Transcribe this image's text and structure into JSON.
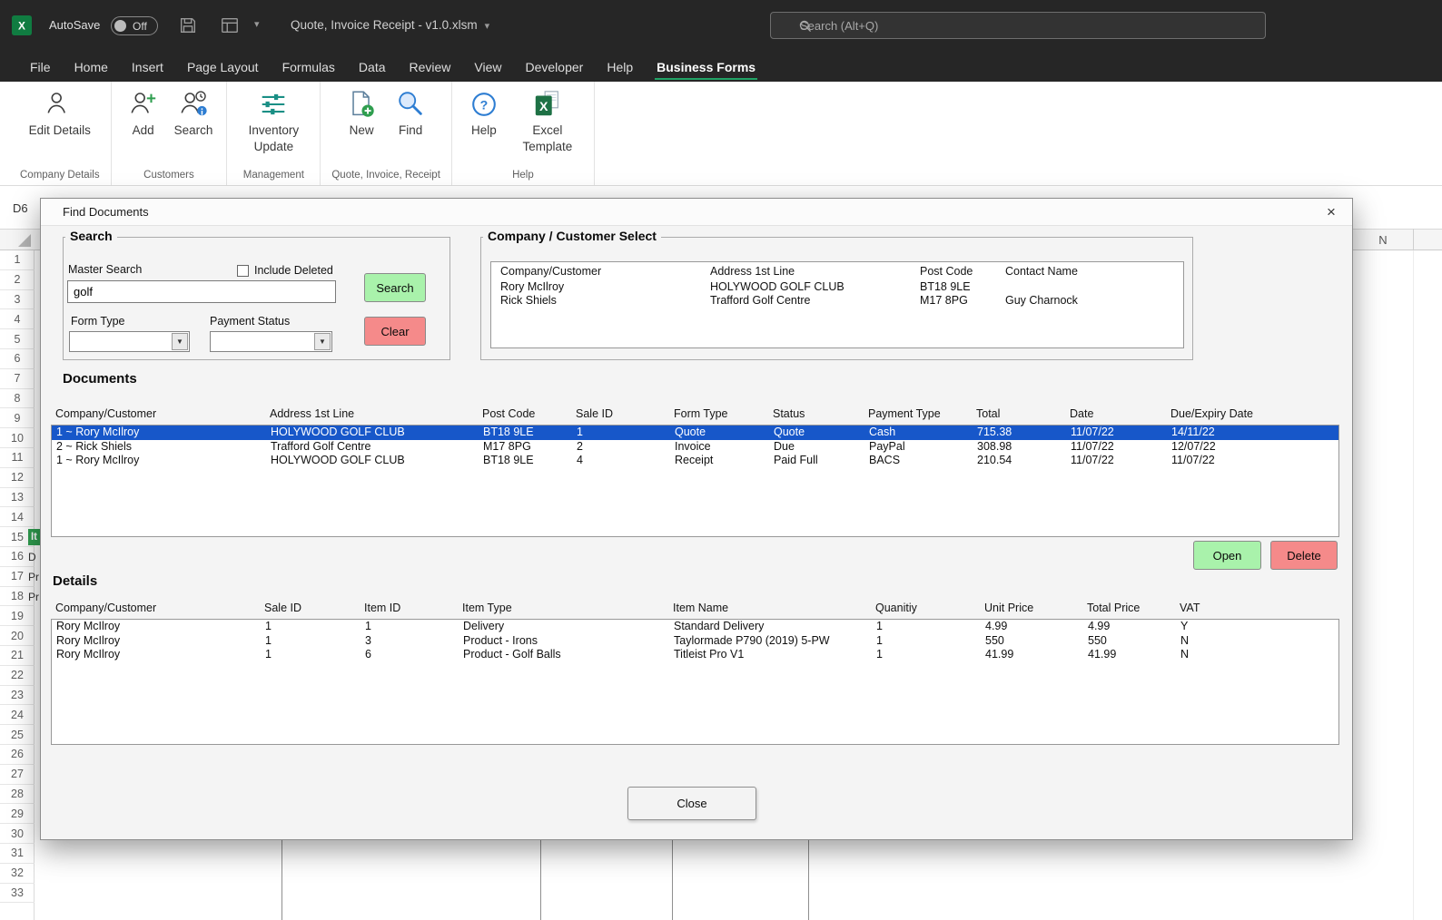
{
  "titlebar": {
    "autosave_label": "AutoSave",
    "autosave_state": "Off",
    "doc_title": "Quote, Invoice Receipt - v1.0.xlsm",
    "search_placeholder": "Search (Alt+Q)"
  },
  "menubar": {
    "items": [
      {
        "label": "File",
        "active": false
      },
      {
        "label": "Home",
        "active": false
      },
      {
        "label": "Insert",
        "active": false
      },
      {
        "label": "Page Layout",
        "active": false
      },
      {
        "label": "Formulas",
        "active": false
      },
      {
        "label": "Data",
        "active": false
      },
      {
        "label": "Review",
        "active": false
      },
      {
        "label": "View",
        "active": false
      },
      {
        "label": "Developer",
        "active": false
      },
      {
        "label": "Help",
        "active": false
      },
      {
        "label": "Business Forms",
        "active": true
      }
    ]
  },
  "ribbon": {
    "groups": [
      {
        "label": "Company Details",
        "buttons": [
          {
            "label": "Edit Details",
            "icon": "person-icon"
          }
        ]
      },
      {
        "label": "Customers",
        "buttons": [
          {
            "label": "Add",
            "icon": "person-add-icon"
          },
          {
            "label": "Search",
            "icon": "person-clock-icon"
          }
        ]
      },
      {
        "label": "Management",
        "buttons": [
          {
            "label": "Inventory Update",
            "icon": "inventory-icon"
          }
        ]
      },
      {
        "label": "Quote, Invoice, Receipt",
        "buttons": [
          {
            "label": "New",
            "icon": "doc-new-icon"
          },
          {
            "label": "Find",
            "icon": "magnifier-icon"
          }
        ]
      },
      {
        "label": "Help",
        "buttons": [
          {
            "label": "Help",
            "icon": "help-icon"
          },
          {
            "label": "Excel Template",
            "icon": "excel-template-icon"
          }
        ]
      }
    ]
  },
  "sheet": {
    "name_box": "D6",
    "col_header": "N",
    "row_numbers": [
      "1",
      "2",
      "3",
      "4",
      "5",
      "6",
      "7",
      "8",
      "9",
      "10",
      "11",
      "12",
      "13",
      "14",
      "15",
      "16",
      "17",
      "18",
      "19",
      "20",
      "21",
      "22",
      "23",
      "24",
      "25",
      "26",
      "27",
      "28",
      "29",
      "30",
      "31",
      "32",
      "33"
    ],
    "cell_fragments": [
      {
        "row": 15,
        "text": "It",
        "green": true
      },
      {
        "row": 16,
        "text": "D",
        "green": false
      },
      {
        "row": 17,
        "text": "Pr",
        "green": false
      },
      {
        "row": 18,
        "text": "Pr",
        "green": false
      }
    ]
  },
  "dialog": {
    "title": "Find Documents",
    "search_group": {
      "label": "Search",
      "master_search_label": "Master Search",
      "master_search_value": "golf",
      "include_deleted_label": "Include Deleted",
      "form_type_label": "Form Type",
      "payment_status_label": "Payment Status",
      "search_button": "Search",
      "clear_button": "Clear"
    },
    "company_select": {
      "label": "Company / Customer Select",
      "columns": [
        "Company/Customer",
        "Address 1st Line",
        "Post Code",
        "Contact Name"
      ],
      "rows": [
        [
          "Rory McIlroy",
          "HOLYWOOD GOLF CLUB",
          "BT18 9LE",
          ""
        ],
        [
          "Rick Shiels",
          "Trafford Golf Centre",
          "M17 8PG",
          "Guy Charnock"
        ]
      ]
    },
    "documents": {
      "label": "Documents",
      "columns": [
        "Company/Customer",
        "Address 1st Line",
        "Post Code",
        "Sale ID",
        "Form Type",
        "Status",
        "Payment Type",
        "Total",
        "Date",
        "Due/Expiry Date"
      ],
      "rows": [
        [
          "1 ~ Rory McIlroy",
          "HOLYWOOD GOLF CLUB",
          "BT18 9LE",
          "1",
          "Quote",
          "Quote",
          "Cash",
          "715.38",
          "11/07/22",
          "14/11/22"
        ],
        [
          "2 ~ Rick Shiels",
          "Trafford Golf Centre",
          "M17 8PG",
          "2",
          "Invoice",
          "Due",
          "PayPal",
          "308.98",
          "11/07/22",
          "12/07/22"
        ],
        [
          "1 ~ Rory McIlroy",
          "HOLYWOOD GOLF CLUB",
          "BT18 9LE",
          "4",
          "Receipt",
          "Paid Full",
          "BACS",
          "210.54",
          "11/07/22",
          "11/07/22"
        ]
      ],
      "selected_index": 0,
      "open_button": "Open",
      "delete_button": "Delete"
    },
    "details": {
      "label": "Details",
      "columns": [
        "Company/Customer",
        "Sale ID",
        "Item ID",
        "Item Type",
        "Item Name",
        "Quanitiy",
        "Unit Price",
        "Total Price",
        "VAT"
      ],
      "rows": [
        [
          "Rory McIlroy",
          "1",
          "1",
          "Delivery",
          "Standard Delivery",
          "1",
          "4.99",
          "4.99",
          "Y"
        ],
        [
          "Rory McIlroy",
          "1",
          "3",
          "Product - Irons",
          "Taylormade P790 (2019) 5-PW",
          "1",
          "550",
          "550",
          "N"
        ],
        [
          "Rory McIlroy",
          "1",
          "6",
          "Product - Golf Balls",
          "Titleist Pro V1",
          "1",
          "41.99",
          "41.99",
          "N"
        ]
      ]
    },
    "close_button": "Close"
  },
  "colors": {
    "ribbon_accent_green": "#21a366",
    "selection_blue": "#1757c9",
    "button_green": "#a9f2ab",
    "button_red": "#f58a8a",
    "titlebar_dark": "#262626"
  }
}
